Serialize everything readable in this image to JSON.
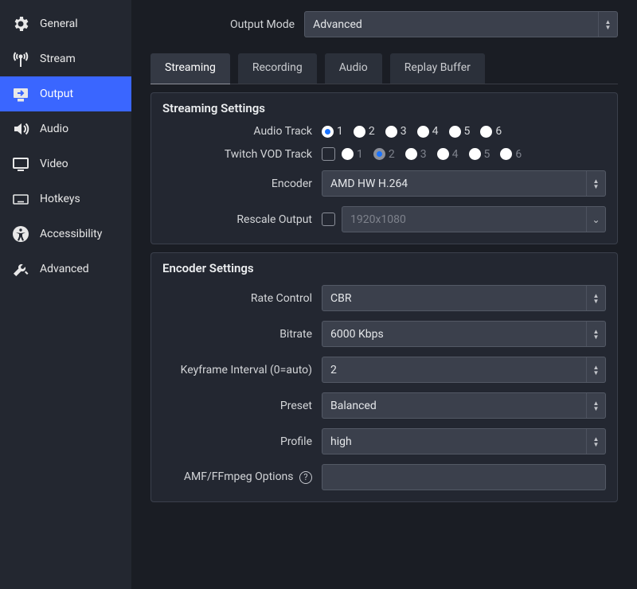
{
  "sidebar": {
    "items": [
      {
        "label": "General"
      },
      {
        "label": "Stream"
      },
      {
        "label": "Output"
      },
      {
        "label": "Audio"
      },
      {
        "label": "Video"
      },
      {
        "label": "Hotkeys"
      },
      {
        "label": "Accessibility"
      },
      {
        "label": "Advanced"
      }
    ],
    "selected": "Output"
  },
  "output_mode": {
    "label": "Output Mode",
    "value": "Advanced"
  },
  "tabs": {
    "items": [
      {
        "label": "Streaming",
        "active": true
      },
      {
        "label": "Recording"
      },
      {
        "label": "Audio"
      },
      {
        "label": "Replay Buffer"
      }
    ]
  },
  "streaming": {
    "heading": "Streaming Settings",
    "audio_track": {
      "label": "Audio Track",
      "options": [
        "1",
        "2",
        "3",
        "4",
        "5",
        "6"
      ],
      "selected": "1"
    },
    "twitch_vod": {
      "label": "Twitch VOD Track",
      "checked": false,
      "options": [
        "1",
        "2",
        "3",
        "4",
        "5",
        "6"
      ],
      "selected": "2"
    },
    "encoder": {
      "label": "Encoder",
      "value": "AMD HW H.264"
    },
    "rescale": {
      "label": "Rescale Output",
      "checked": false,
      "value": "1920x1080"
    }
  },
  "encoder_settings": {
    "heading": "Encoder Settings",
    "rate_control": {
      "label": "Rate Control",
      "value": "CBR"
    },
    "bitrate": {
      "label": "Bitrate",
      "value": "6000 Kbps"
    },
    "keyframe": {
      "label": "Keyframe Interval (0=auto)",
      "value": "2"
    },
    "preset": {
      "label": "Preset",
      "value": "Balanced"
    },
    "profile": {
      "label": "Profile",
      "value": "high"
    },
    "amf": {
      "label": "AMF/FFmpeg Options",
      "value": ""
    }
  }
}
